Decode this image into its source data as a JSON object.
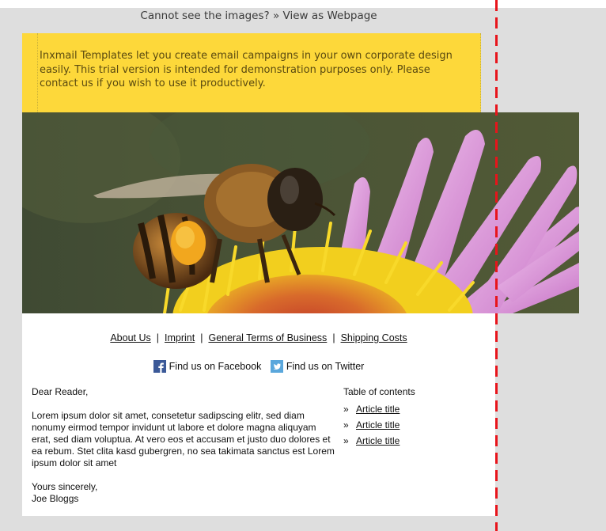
{
  "preheader": {
    "text": "Cannot see the images?",
    "link": "» View as Webpage"
  },
  "notice": {
    "text": "Inxmail Templates let you create email campaigns in your own corporate design easily. This trial version is intended for demonstration purposes only. Please contact us if you wish to use it productively."
  },
  "nav": {
    "items": [
      "About Us",
      "Imprint",
      "General Terms of Business",
      "Shipping Costs"
    ],
    "separator": "|"
  },
  "social": {
    "facebook": {
      "label": "Find us on Facebook",
      "icon": "facebook-icon",
      "color": "#3b5998"
    },
    "twitter": {
      "label": "Find us on Twitter",
      "icon": "twitter-icon",
      "color": "#5aa7dc"
    }
  },
  "body": {
    "greeting": "Dear Reader,",
    "paragraph": "Lorem ipsum dolor sit amet, consetetur sadipscing elitr, sed diam nonumy eirmod tempor invidunt ut labore et dolore magna aliquyam erat, sed diam voluptua. At vero eos et accusam et justo duo dolores et ea rebum. Stet clita kasd gubergren, no sea takimata sanctus est Lorem ipsum dolor sit amet",
    "closing": "Yours sincerely,",
    "signature": "Joe Bloggs"
  },
  "toc": {
    "title": "Table of contents",
    "bullet": "»",
    "items": [
      "Article title",
      "Article title",
      "Article title"
    ]
  },
  "colors": {
    "notice_bg": "#fdd83a",
    "page_bg": "#dedede",
    "guide_line": "#e8141b"
  },
  "hero": {
    "image": "bee-on-pink-flower"
  }
}
